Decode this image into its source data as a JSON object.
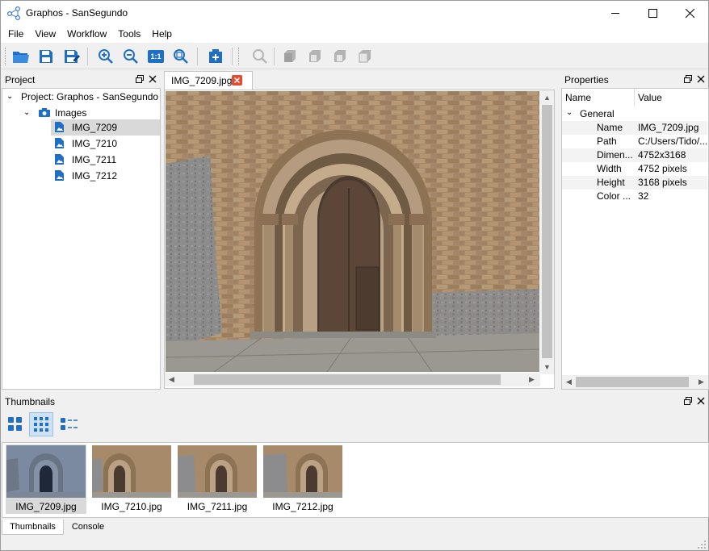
{
  "window": {
    "title": "Graphos - SanSegundo"
  },
  "menu": [
    "File",
    "View",
    "Workflow",
    "Tools",
    "Help"
  ],
  "toolbar": {
    "zoom_actual_label": "1:1"
  },
  "project_panel": {
    "title": "Project",
    "root_label": "Project: Graphos - SanSegundo",
    "folder_label": "Images",
    "items": [
      "IMG_7209",
      "IMG_7210",
      "IMG_7211",
      "IMG_7212"
    ],
    "selected_index": 0
  },
  "editor": {
    "tab_label": "IMG_7209.jpg"
  },
  "properties_panel": {
    "title": "Properties",
    "headers": [
      "Name",
      "Value"
    ],
    "group_label": "General",
    "rows": [
      {
        "name": "Name",
        "value": "IMG_7209.jpg"
      },
      {
        "name": "Path",
        "value": "C:/Users/Tido/..."
      },
      {
        "name": "Dimen...",
        "value": "4752x3168"
      },
      {
        "name": "Width",
        "value": "4752 pixels"
      },
      {
        "name": "Height",
        "value": "3168 pixels"
      },
      {
        "name": "Color ...",
        "value": "32"
      }
    ]
  },
  "thumbnails_panel": {
    "title": "Thumbnails",
    "items": [
      "IMG_7209.jpg",
      "IMG_7210.jpg",
      "IMG_7211.jpg",
      "IMG_7212.jpg"
    ],
    "selected_index": 0
  },
  "bottom_tabs": [
    "Thumbnails",
    "Console"
  ],
  "colors": {
    "icon_blue": "#1f6fc5",
    "close_red": "#e34c2f"
  }
}
